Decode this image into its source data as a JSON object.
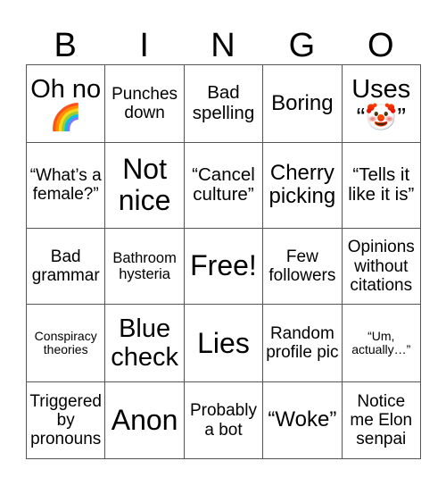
{
  "header": {
    "letters": [
      "B",
      "I",
      "N",
      "G",
      "O"
    ]
  },
  "grid": [
    [
      "Oh no 🌈",
      "Punches down",
      "Bad spelling",
      "Boring",
      "Uses “🤡”"
    ],
    [
      "“What’s a female?”",
      "Not nice",
      "“Cancel culture”",
      "Cherry picking",
      "“Tells it like it is”"
    ],
    [
      "Bad grammar",
      "Bathroom hysteria",
      "Free!",
      "Few followers",
      "Opinions without citations"
    ],
    [
      "Conspiracy theories",
      "Blue check",
      "Lies",
      "Random profile pic",
      "“Um, actually…”"
    ],
    [
      "Triggered by pronouns",
      "Anon",
      "Probably a bot",
      "“Woke”",
      "Notice me Elon senpai"
    ]
  ],
  "icons": {
    "rainbow": "rainbow-emoji",
    "clown": "clown-face-emoji"
  },
  "colors": {
    "grid_line": "#555555",
    "text": "#000000",
    "background": "#ffffff"
  }
}
